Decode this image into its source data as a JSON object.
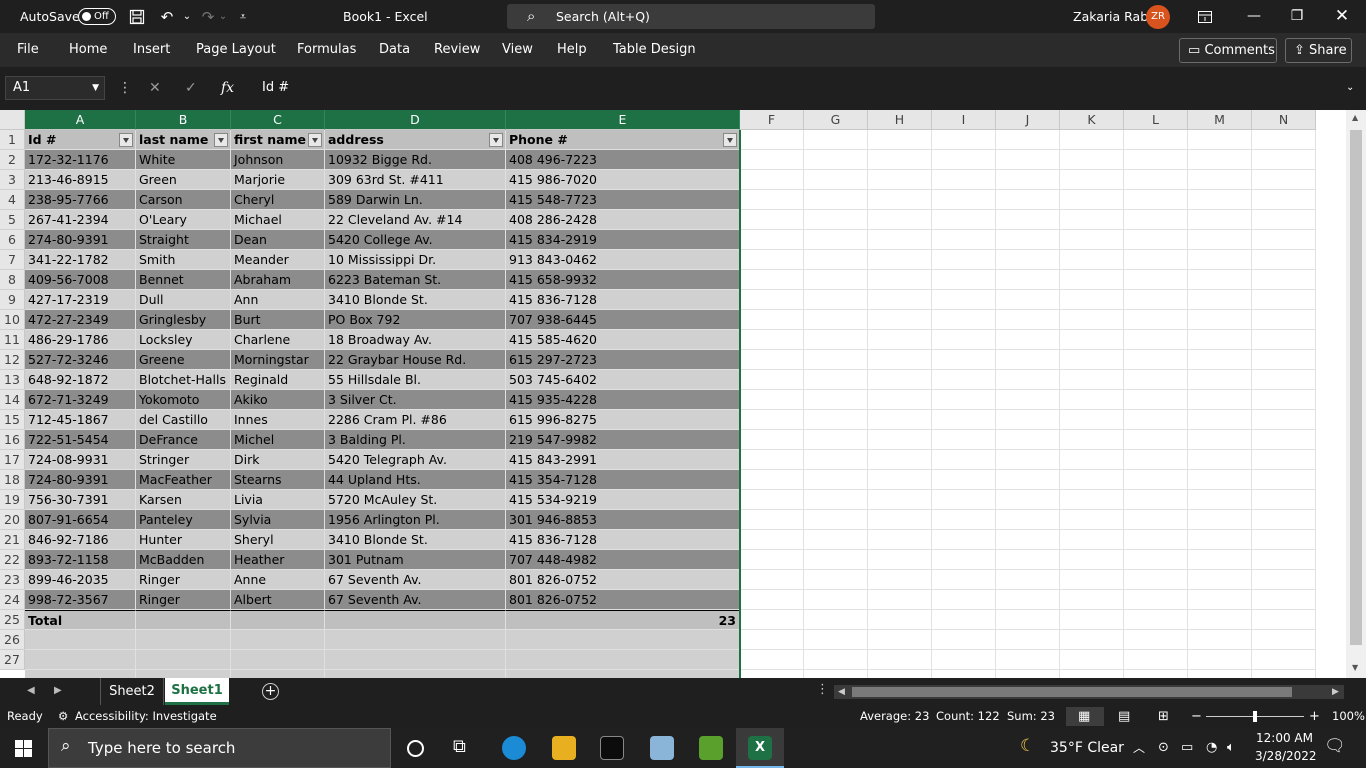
{
  "titlebar": {
    "autosave_label": "AutoSave",
    "autosave_state": "Off",
    "document_title": "Book1  -  Excel",
    "search_placeholder": "Search (Alt+Q)",
    "user_name": "Zakaria Rab",
    "user_initials": "ZR"
  },
  "ribbon": {
    "tabs": [
      "File",
      "Home",
      "Insert",
      "Page Layout",
      "Formulas",
      "Data",
      "Review",
      "View",
      "Help",
      "Table Design"
    ],
    "comments_label": "Comments",
    "share_label": "Share"
  },
  "formula_bar": {
    "name_box": "A1",
    "formula_value": "Id #"
  },
  "columns": [
    "A",
    "B",
    "C",
    "D",
    "E",
    "F",
    "G",
    "H",
    "I",
    "J",
    "K",
    "L",
    "M",
    "N"
  ],
  "row_numbers": [
    "1",
    "2",
    "3",
    "4",
    "5",
    "6",
    "7",
    "8",
    "9",
    "10",
    "11",
    "12",
    "13",
    "14",
    "15",
    "16",
    "17",
    "18",
    "19",
    "20",
    "21",
    "22",
    "23",
    "24",
    "25",
    "26",
    "27"
  ],
  "table": {
    "headers": [
      "Id #",
      "last name",
      "first name",
      "address",
      "Phone #"
    ],
    "rows": [
      [
        "172-32-1176",
        "White",
        "Johnson",
        "10932 Bigge Rd.",
        "408 496-7223"
      ],
      [
        "213-46-8915",
        "Green",
        "Marjorie",
        "309 63rd St. #411",
        "415 986-7020"
      ],
      [
        "238-95-7766",
        "Carson",
        "Cheryl",
        "589 Darwin Ln.",
        "415 548-7723"
      ],
      [
        "267-41-2394",
        "O'Leary",
        "Michael",
        "22 Cleveland Av. #14",
        "408 286-2428"
      ],
      [
        "274-80-9391",
        "Straight",
        "Dean",
        "5420 College Av.",
        "415 834-2919"
      ],
      [
        "341-22-1782",
        "Smith",
        "Meander",
        "10 Mississippi Dr.",
        "913 843-0462"
      ],
      [
        "409-56-7008",
        "Bennet",
        "Abraham",
        "6223 Bateman St.",
        "415 658-9932"
      ],
      [
        "427-17-2319",
        "Dull",
        "Ann",
        "3410 Blonde St.",
        "415 836-7128"
      ],
      [
        "472-27-2349",
        "Gringlesby",
        "Burt",
        "PO Box 792",
        "707 938-6445"
      ],
      [
        "486-29-1786",
        "Locksley",
        "Charlene",
        "18 Broadway Av.",
        "415 585-4620"
      ],
      [
        "527-72-3246",
        "Greene",
        "Morningstar",
        "22 Graybar House Rd.",
        "615 297-2723"
      ],
      [
        "648-92-1872",
        "Blotchet-Halls",
        "Reginald",
        "55 Hillsdale Bl.",
        "503 745-6402"
      ],
      [
        "672-71-3249",
        "Yokomoto",
        "Akiko",
        "3 Silver Ct.",
        "415 935-4228"
      ],
      [
        "712-45-1867",
        "del Castillo",
        "Innes",
        "2286 Cram Pl. #86",
        "615 996-8275"
      ],
      [
        "722-51-5454",
        "DeFrance",
        "Michel",
        "3 Balding Pl.",
        "219 547-9982"
      ],
      [
        "724-08-9931",
        "Stringer",
        "Dirk",
        "5420 Telegraph Av.",
        "415 843-2991"
      ],
      [
        "724-80-9391",
        "MacFeather",
        "Stearns",
        "44 Upland Hts.",
        "415 354-7128"
      ],
      [
        "756-30-7391",
        "Karsen",
        "Livia",
        "5720 McAuley St.",
        "415 534-9219"
      ],
      [
        "807-91-6654",
        "Panteley",
        "Sylvia",
        "1956 Arlington Pl.",
        "301 946-8853"
      ],
      [
        "846-92-7186",
        "Hunter",
        "Sheryl",
        "3410 Blonde St.",
        "415 836-7128"
      ],
      [
        "893-72-1158",
        "McBadden",
        "Heather",
        "301 Putnam",
        "707 448-4982"
      ],
      [
        "899-46-2035",
        "Ringer",
        "Anne",
        "67 Seventh Av.",
        "801 826-0752"
      ],
      [
        "998-72-3567",
        "Ringer",
        "Albert",
        "67 Seventh Av.",
        "801 826-0752"
      ]
    ],
    "total_label": "Total",
    "total_value": "23"
  },
  "sheets": {
    "tabs": [
      "Sheet2",
      "Sheet1"
    ],
    "active": "Sheet1"
  },
  "statusbar": {
    "ready": "Ready",
    "accessibility": "Accessibility: Investigate",
    "average": "Average: 23",
    "count": "Count: 122",
    "sum": "Sum: 23",
    "zoom": "100%"
  },
  "taskbar": {
    "search_placeholder": "Type here to search",
    "weather": "35°F  Clear",
    "time": "12:00 AM",
    "date": "3/28/2022"
  },
  "colors": {
    "excel_green": "#1e7145",
    "band_dark": "#8c8c8c",
    "band_light": "#d0d0d0",
    "avatar": "#d9531e"
  }
}
